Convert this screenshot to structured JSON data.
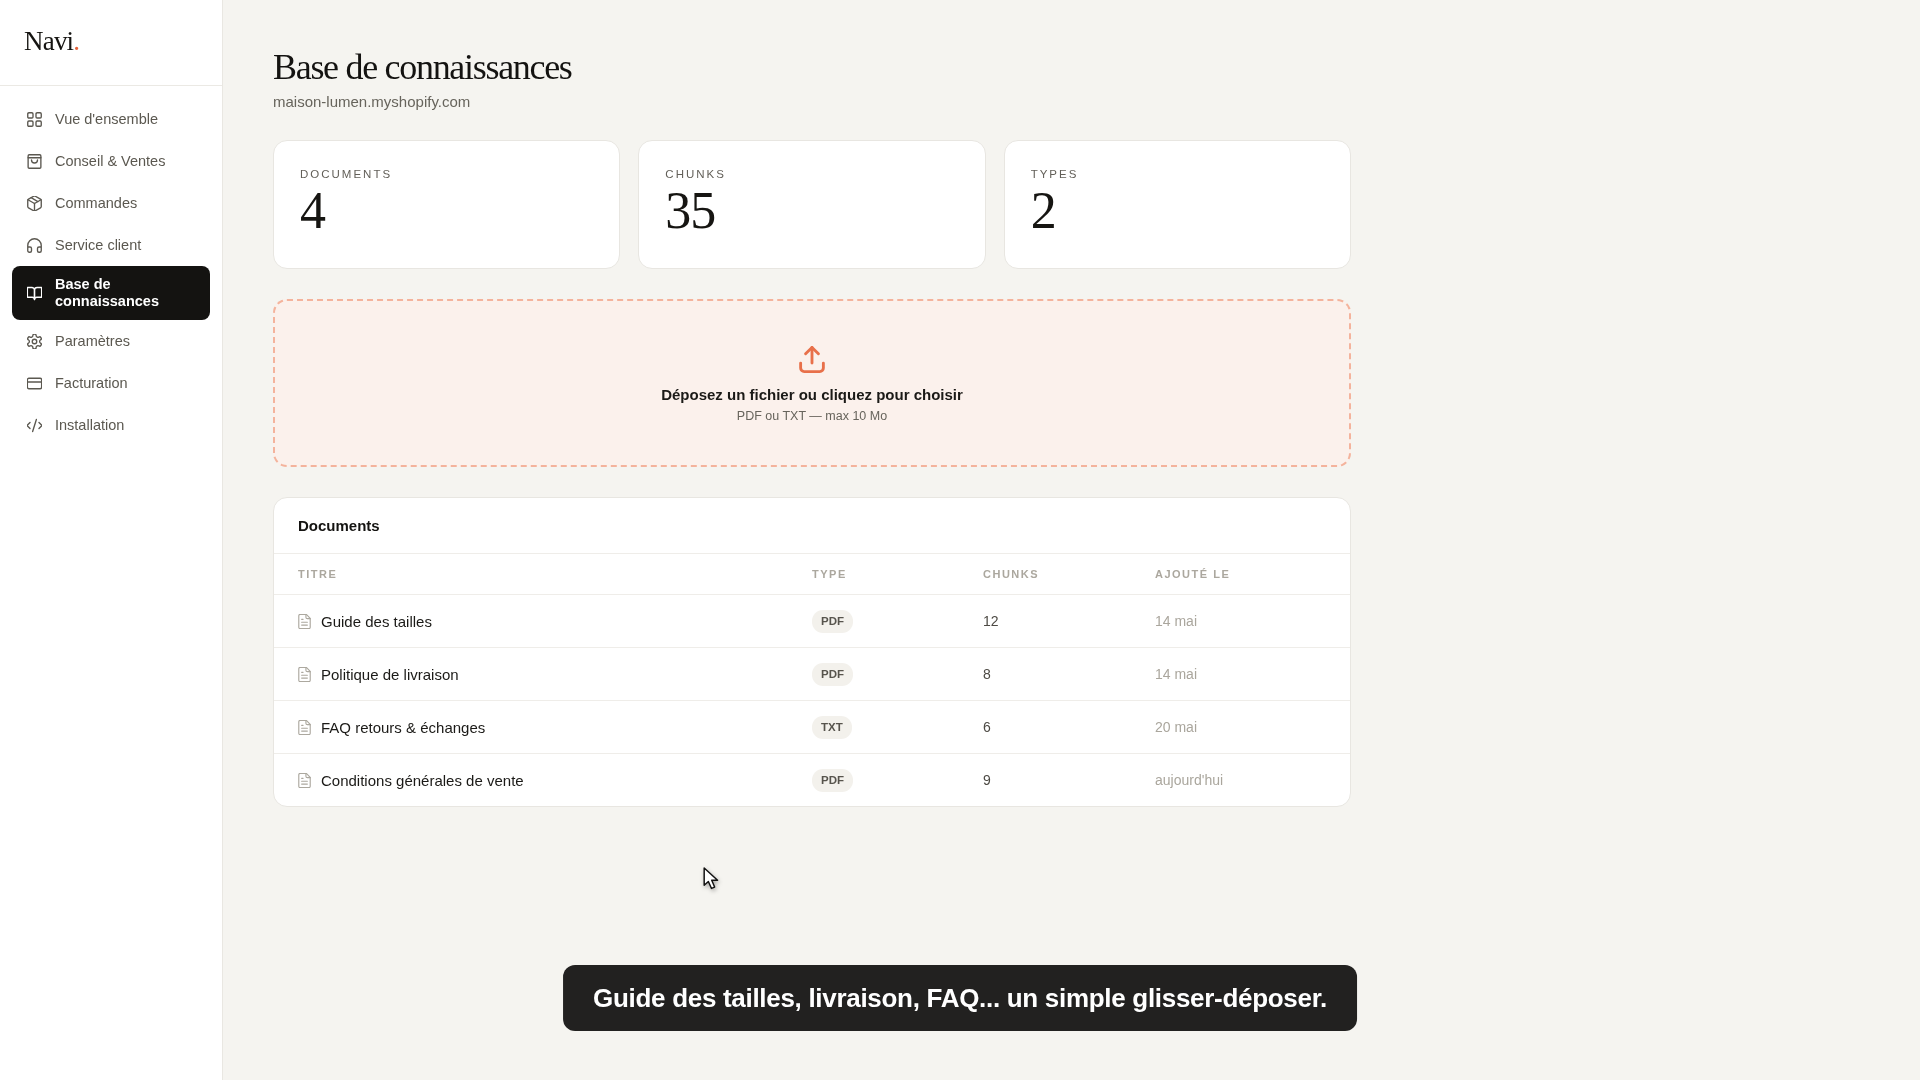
{
  "sidebar": {
    "logo": "Navi.",
    "items": [
      {
        "label": "Vue d'ensemble",
        "selected": false
      },
      {
        "label": "Conseil & Ventes",
        "selected": false
      },
      {
        "label": "Commandes",
        "selected": false
      },
      {
        "label": "Service client",
        "selected": false
      },
      {
        "label": "Base de connaissances",
        "selected": true
      },
      {
        "label": "Paramètres",
        "selected": false
      },
      {
        "label": "Facturation",
        "selected": false
      },
      {
        "label": "Installation",
        "selected": false
      }
    ]
  },
  "header": {
    "title": "Base de connaissances",
    "subtitle": "maison-lumen.myshopify.com"
  },
  "stats": [
    {
      "label": "DOCUMENTS",
      "value": "4"
    },
    {
      "label": "CHUNKS",
      "value": "35"
    },
    {
      "label": "TYPES",
      "value": "2"
    }
  ],
  "upload": {
    "title": "Déposez un fichier ou cliquez pour choisir",
    "hint": "PDF ou TXT — max 10 Mo"
  },
  "documents": {
    "title": "Documents",
    "columns": [
      "TITRE",
      "TYPE",
      "CHUNKS",
      "AJOUTÉ LE"
    ],
    "rows": [
      {
        "title": "Guide des tailles",
        "type": "PDF",
        "chunks": "12",
        "added": "14 mai"
      },
      {
        "title": "Politique de livraison",
        "type": "PDF",
        "chunks": "8",
        "added": "14 mai"
      },
      {
        "title": "FAQ retours & échanges",
        "type": "TXT",
        "chunks": "6",
        "added": "20 mai"
      },
      {
        "title": "Conditions générales de vente",
        "type": "PDF",
        "chunks": "9",
        "added": "aujourd'hui"
      }
    ]
  },
  "caption": "Guide des tailles, livraison, FAQ... un simple glisser-déposer."
}
